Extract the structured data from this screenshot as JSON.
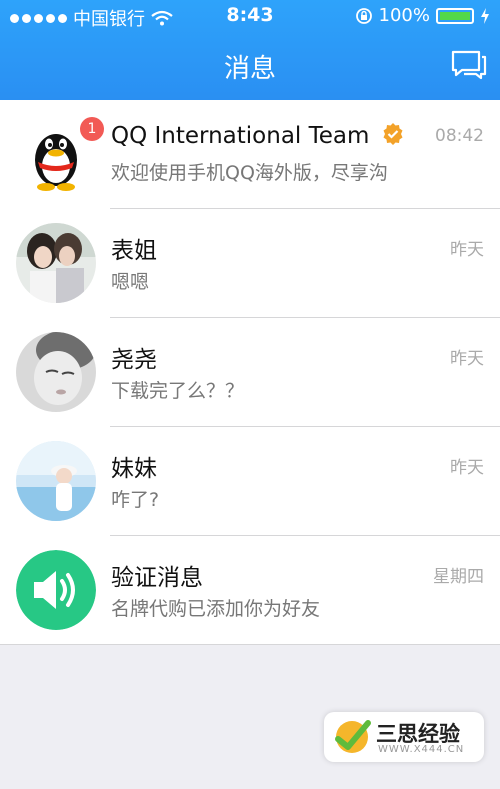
{
  "status_bar": {
    "carrier": "中国银行",
    "time": "8:43",
    "battery": "100%"
  },
  "header": {
    "title": "消息",
    "action_icon": "chat-bubbles-icon"
  },
  "conversations": [
    {
      "name": "QQ International Team",
      "message": "欢迎使用手机QQ海外版，尽享沟",
      "time": "08:42",
      "unread": "1",
      "verified": true
    },
    {
      "name": "表姐",
      "message": "嗯嗯",
      "time": "昨天"
    },
    {
      "name": "尧尧",
      "message": "下载完了么？？",
      "time": "昨天"
    },
    {
      "name": "妹妹",
      "message": "咋了?",
      "time": "昨天"
    },
    {
      "name": "验证消息",
      "message": "名牌代购已添加你为好友",
      "time": "星期四"
    }
  ],
  "watermark": {
    "text": "三思经验",
    "url": "WWW.X444.CN"
  },
  "colors": {
    "header": "#2a8ff2",
    "badge": "#f25a55",
    "verify_icon": "#27c885",
    "verified_badge": "#f3a229"
  }
}
